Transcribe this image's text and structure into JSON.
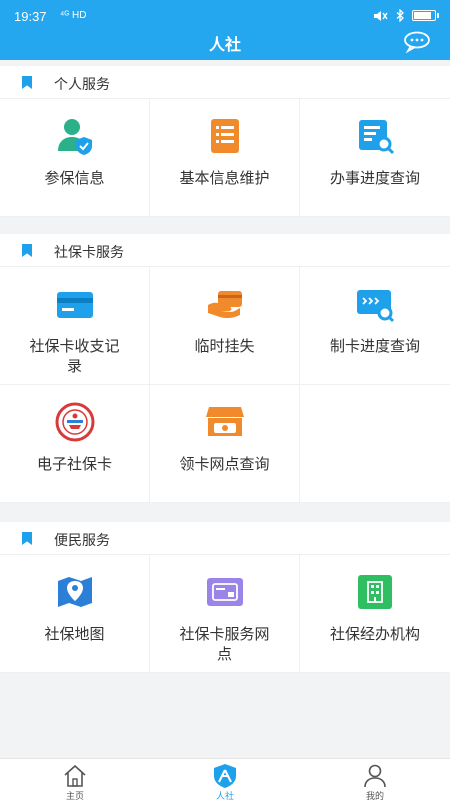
{
  "status_bar": {
    "time": "19:37",
    "network": "⁴ᴳ HD"
  },
  "header": {
    "title": "人社"
  },
  "sections": [
    {
      "title": "个人服务",
      "items": [
        {
          "label": "参保信息",
          "icon": "person-shield-icon"
        },
        {
          "label": "基本信息维护",
          "icon": "document-list-icon"
        },
        {
          "label": "办事进度查询",
          "icon": "search-document-icon"
        }
      ]
    },
    {
      "title": "社保卡服务",
      "items": [
        {
          "label": "社保卡收支记录",
          "icon": "card-icon"
        },
        {
          "label": "临时挂失",
          "icon": "card-hand-icon"
        },
        {
          "label": "制卡进度查询",
          "icon": "card-search-icon"
        },
        {
          "label": "电子社保卡",
          "icon": "emblem-icon"
        },
        {
          "label": "领卡网点查询",
          "icon": "store-icon"
        }
      ]
    },
    {
      "title": "便民服务",
      "items": [
        {
          "label": "社保地图",
          "icon": "map-pin-icon"
        },
        {
          "label": "社保卡服务网点",
          "icon": "card-service-icon"
        },
        {
          "label": "社保经办机构",
          "icon": "building-icon"
        }
      ]
    }
  ],
  "tabbar": [
    {
      "label": "主页",
      "icon": "home-icon"
    },
    {
      "label": "人社",
      "icon": "people-icon",
      "active": true
    },
    {
      "label": "我的",
      "icon": "user-icon"
    }
  ],
  "colors": {
    "primary": "#25a7f0",
    "accent": "#1ea0ea",
    "orange": "#f08a2a",
    "purple": "#9b84e8",
    "green": "#2fbe61"
  }
}
